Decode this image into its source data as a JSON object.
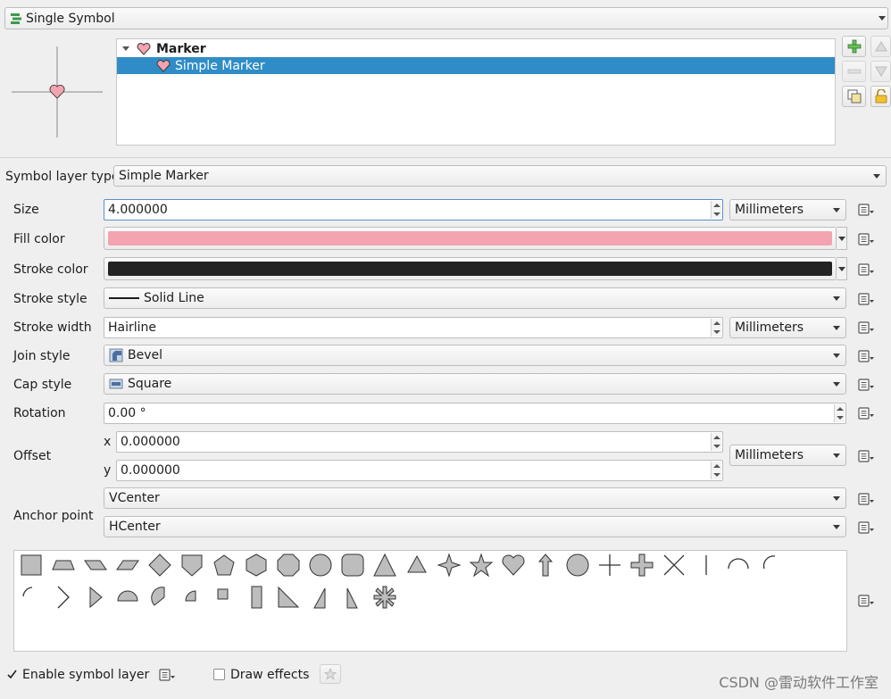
{
  "renderer_combo": {
    "value": "Single Symbol",
    "icon": "single-symbol-icon"
  },
  "symbol_tree": {
    "items": [
      {
        "label": "Marker",
        "icon": "heart-icon",
        "expanded": true,
        "selected": false
      },
      {
        "label": "Simple Marker",
        "icon": "heart-icon",
        "selected": true
      }
    ]
  },
  "symbol_layer_type": {
    "label": "Symbol layer type",
    "value": "Simple Marker"
  },
  "properties": {
    "size": {
      "label": "Size",
      "value": "4.000000",
      "unit": "Millimeters"
    },
    "fill_color": {
      "label": "Fill color",
      "color": "#f4a3b0"
    },
    "stroke_color": {
      "label": "Stroke color",
      "color": "#232323"
    },
    "stroke_style": {
      "label": "Stroke style",
      "value": "Solid Line"
    },
    "stroke_width": {
      "label": "Stroke width",
      "value": "Hairline",
      "unit": "Millimeters"
    },
    "join_style": {
      "label": "Join style",
      "value": "Bevel"
    },
    "cap_style": {
      "label": "Cap style",
      "value": "Square"
    },
    "rotation": {
      "label": "Rotation",
      "value": "0.00 °"
    },
    "offset": {
      "label": "Offset",
      "x_label": "x",
      "x": "0.000000",
      "y_label": "y",
      "y": "0.000000",
      "unit": "Millimeters"
    },
    "anchor_point": {
      "label": "Anchor point",
      "vertical": "VCenter",
      "horizontal": "HCenter"
    }
  },
  "shape_palette": [
    "square",
    "trapezoid",
    "parallelogram-right",
    "parallelogram-left",
    "diamond",
    "shield",
    "pentagon",
    "hexagon",
    "octagon",
    "decagon",
    "rounded-square",
    "triangle",
    "equilateral-triangle",
    "star-diamond",
    "star",
    "heart",
    "arrow",
    "circle",
    "cross",
    "cross-fill",
    "cross2",
    "line",
    "semi-arc",
    "third-arc",
    "quarter-arc",
    "arrowhead",
    "filled-arrowhead",
    "semicircle",
    "third-circle",
    "quarter-circle",
    "quarter-square",
    "half-square",
    "diagonal-half-square",
    "right-half-triangle",
    "left-half-triangle",
    "asterisk-fill"
  ],
  "footer": {
    "enable_symbol_layer": {
      "label": "Enable symbol layer",
      "checked": true
    },
    "draw_effects": {
      "label": "Draw effects",
      "checked": false
    }
  },
  "watermark": "CSDN @雷动软件工作室",
  "colors": {
    "selection": "#308cc6",
    "fill": "#f4a3b0",
    "stroke": "#232323"
  }
}
